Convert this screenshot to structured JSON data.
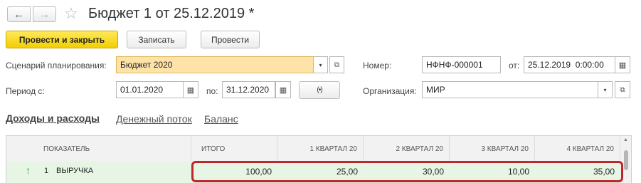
{
  "window": {
    "title": "Бюджет 1 от 25.12.2019 *"
  },
  "toolbar": {
    "post_close_label": "Провести и закрыть",
    "save_label": "Записать",
    "post_label": "Провести"
  },
  "form": {
    "scenario_label": "Сценарий планирования:",
    "scenario_value": "Бюджет 2020",
    "number_label": "Номер:",
    "number_value": "НФНФ-000001",
    "date_from_label": "от:",
    "date_value": "25.12.2019  0:00:00",
    "period_label": "Период с:",
    "period_from": "01.01.2020",
    "period_to_label": "по:",
    "period_to": "31.12.2020",
    "org_label": "Организация:",
    "org_value": "МИР"
  },
  "tabs": [
    {
      "label": "Доходы и расходы",
      "active": true
    },
    {
      "label": "Денежный поток",
      "active": false
    },
    {
      "label": "Баланс",
      "active": false
    }
  ],
  "table": {
    "headers": [
      "ПОКАЗАТЕЛЬ",
      "ИТОГО",
      "1 КВАРТАЛ 20",
      "2 КВАРТАЛ 20",
      "3 КВАРТАЛ 20",
      "4 КВАРТАЛ 20"
    ],
    "rows": [
      {
        "number": "1",
        "name": "ВЫРУЧКА",
        "total": "100,00",
        "q1": "25,00",
        "q2": "30,00",
        "q3": "10,00",
        "q4": "35,00"
      }
    ]
  },
  "colors": {
    "accent_yellow": "#f7d917",
    "scenario_field": "#fde3a7",
    "row_green": "#e6f5e4",
    "highlight_red": "#c0272d",
    "arrow_green": "#2e9b3a"
  }
}
